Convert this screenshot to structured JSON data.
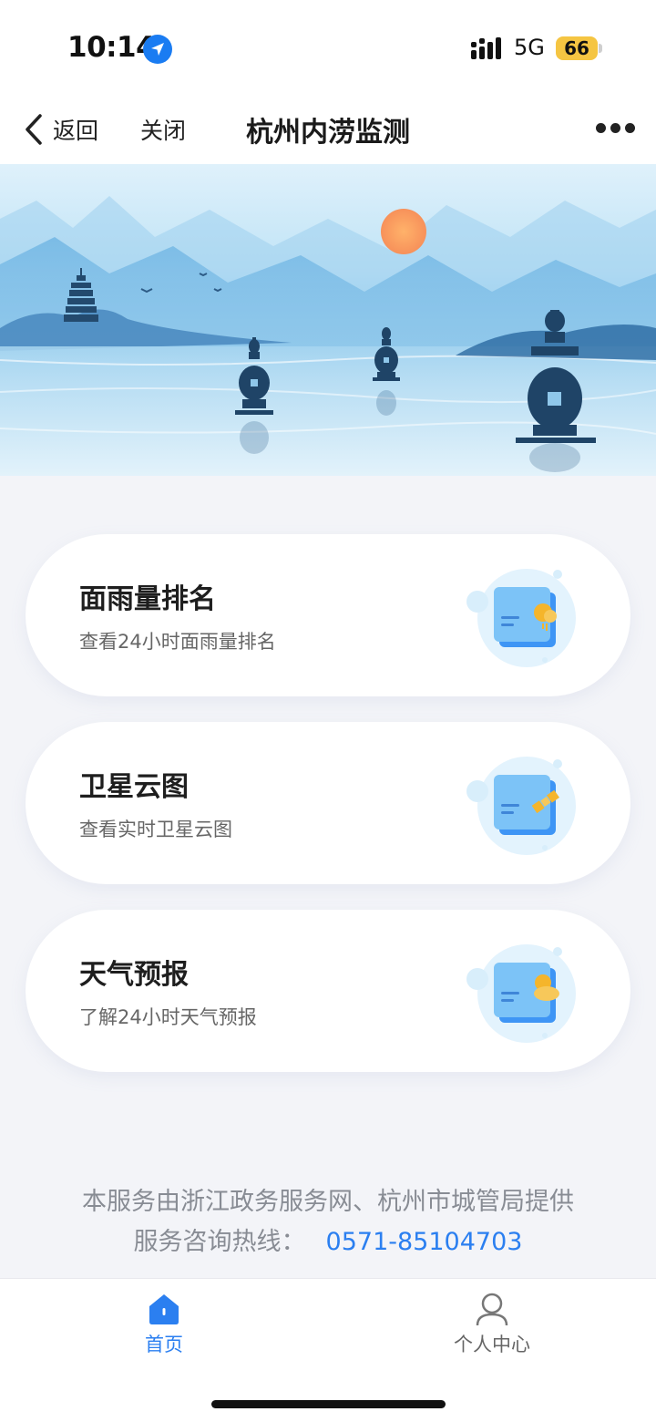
{
  "status_bar": {
    "time": "10:14",
    "network": "5G",
    "battery": "66",
    "icons": [
      "location-arrow-icon",
      "signal-icon",
      "battery-icon"
    ]
  },
  "nav": {
    "back_label": "返回",
    "close_label": "关闭",
    "title": "杭州内涝监测",
    "icons": [
      "chevron-left-icon",
      "more-icon"
    ]
  },
  "cards": [
    {
      "title": "面雨量排名",
      "subtitle": "查看24小时面雨量排名",
      "icon": "rain-ranking-icon"
    },
    {
      "title": "卫星云图",
      "subtitle": "查看实时卫星云图",
      "icon": "satellite-icon"
    },
    {
      "title": "天气预报",
      "subtitle": "了解24小时天气预报",
      "icon": "weather-sun-cloud-icon"
    }
  ],
  "footer": {
    "provider": "本服务由浙江政务服务网、杭州市城管局提供",
    "hotline_label": "服务咨询热线：",
    "hotline_number": "0571-85104703"
  },
  "tab_bar": {
    "tabs": [
      {
        "label": "首页",
        "icon": "home-icon",
        "active": true
      },
      {
        "label": "个人中心",
        "icon": "user-icon",
        "active": false
      }
    ]
  },
  "colors": {
    "accent": "#2b7ff0",
    "battery": "#f5c542",
    "background": "#f3f4f8"
  }
}
